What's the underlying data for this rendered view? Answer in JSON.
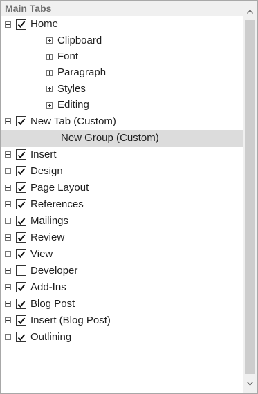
{
  "header": {
    "title": "Main Tabs"
  },
  "tree": {
    "items": [
      {
        "label": "Home",
        "checked": true,
        "expanded": true,
        "children": [
          "Clipboard",
          "Font",
          "Paragraph",
          "Styles",
          "Editing"
        ]
      },
      {
        "label": "New Tab (Custom)",
        "checked": true,
        "expanded": true,
        "group": "New Group (Custom)"
      },
      {
        "label": "Insert",
        "checked": true
      },
      {
        "label": "Design",
        "checked": true
      },
      {
        "label": "Page Layout",
        "checked": true
      },
      {
        "label": "References",
        "checked": true
      },
      {
        "label": "Mailings",
        "checked": true
      },
      {
        "label": "Review",
        "checked": true
      },
      {
        "label": "View",
        "checked": true
      },
      {
        "label": "Developer",
        "checked": false
      },
      {
        "label": "Add-Ins",
        "checked": true
      },
      {
        "label": "Blog Post",
        "checked": true
      },
      {
        "label": "Insert (Blog Post)",
        "checked": true
      },
      {
        "label": "Outlining",
        "checked": true
      }
    ]
  },
  "colors": {
    "selected_row": "#dcdcdc",
    "header_bg": "#f0f0f0",
    "scroll_thumb": "#cdcdcd"
  }
}
